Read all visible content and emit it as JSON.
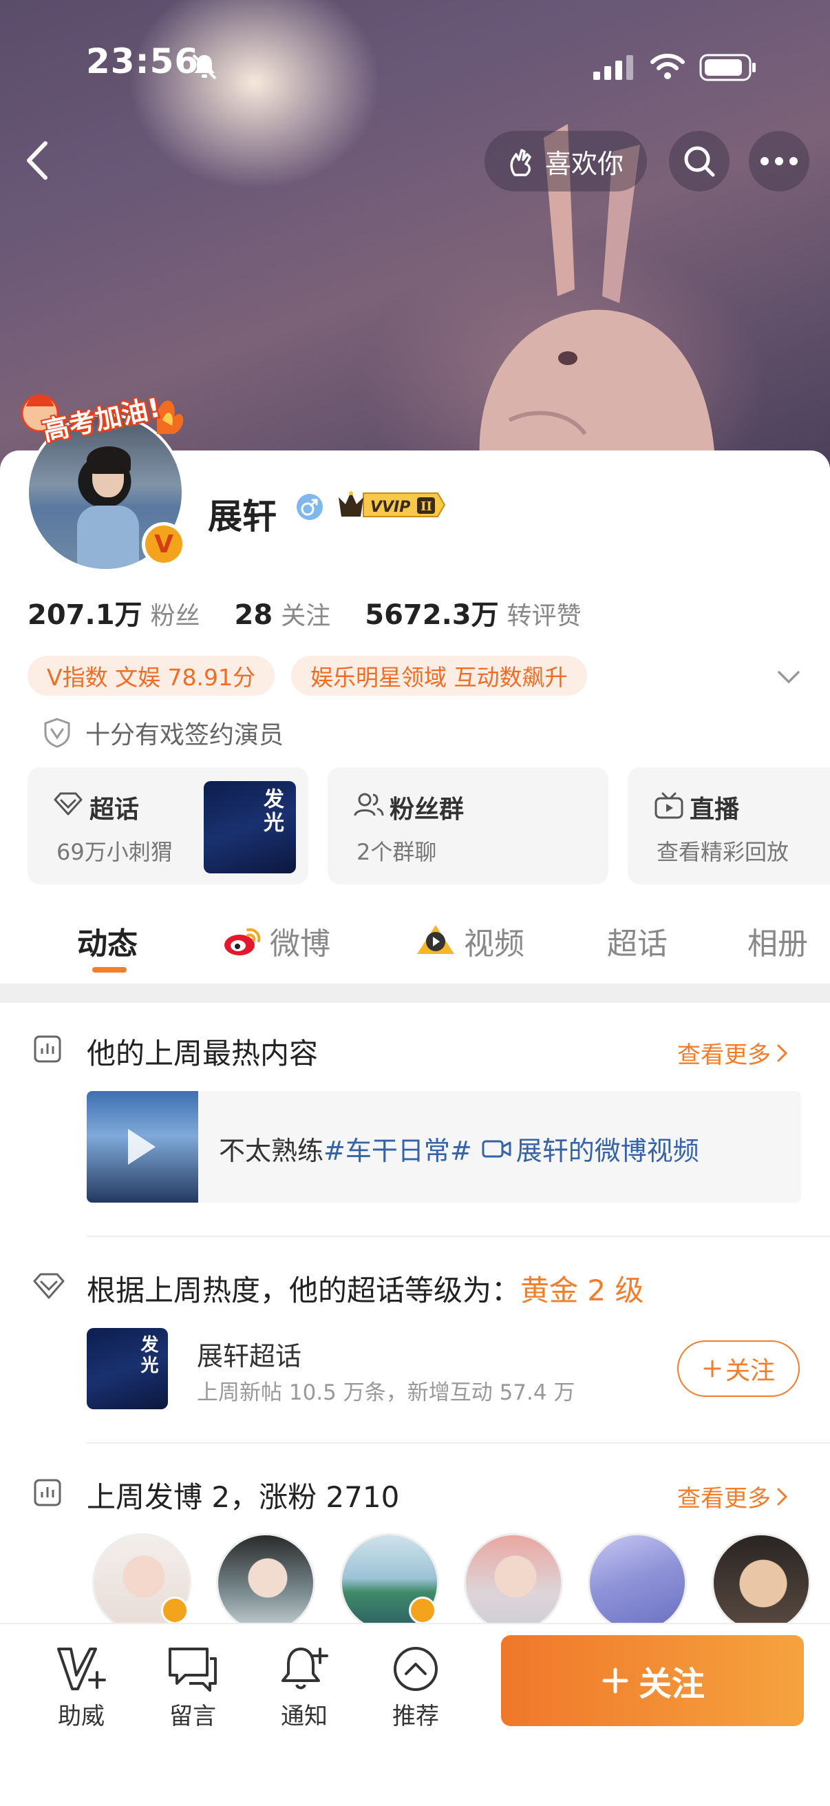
{
  "status_bar": {
    "time": "23:56"
  },
  "header": {
    "like_label": "喜欢你"
  },
  "profile": {
    "sticker_text": "高考加油!",
    "name": "展轩",
    "vvip_label": "VVIP",
    "vvip_level": "II",
    "verified_badge": "V",
    "stats": [
      {
        "value": "207.1万",
        "label": "粉丝"
      },
      {
        "value": "28",
        "label": "关注"
      },
      {
        "value": "5672.3万",
        "label": "转评赞"
      }
    ],
    "tags": [
      "V指数 文娱 78.91分",
      "娱乐明星领域 互动数飙升"
    ],
    "certification": "十分有戏签约演员"
  },
  "tiles": [
    {
      "title": "超话",
      "subtitle": "69万小刺猬",
      "thumb_text": "发光"
    },
    {
      "title": "粉丝群",
      "subtitle": "2个群聊"
    },
    {
      "title": "直播",
      "subtitle": "查看精彩回放"
    }
  ],
  "tabs": [
    "动态",
    "微博",
    "视频",
    "超话",
    "相册"
  ],
  "feed": {
    "hot_title": "他的上周最热内容",
    "more_label": "查看更多",
    "video_prefix": "不太熟练",
    "video_topic": "#车干日常#",
    "video_source": "展轩的微博视频",
    "level_prefix": "根据上周热度，他的超话等级为：",
    "level_value": "黄金 2 级",
    "supertopic_name": "展轩超话",
    "supertopic_stats": "上周新帖 10.5 万条，新增互动 57.4 万",
    "follow_small": "关注",
    "posts_summary": "上周发博 2，涨粉 2710",
    "more_label_2": "查看更多"
  },
  "bottom_bar": {
    "items": [
      "助威",
      "留言",
      "通知",
      "推荐"
    ],
    "follow_label": "关注"
  },
  "colors": {
    "accent": "#f27d2b",
    "topic_blue": "#3563a8",
    "badge_gold": "#f3a31c"
  }
}
